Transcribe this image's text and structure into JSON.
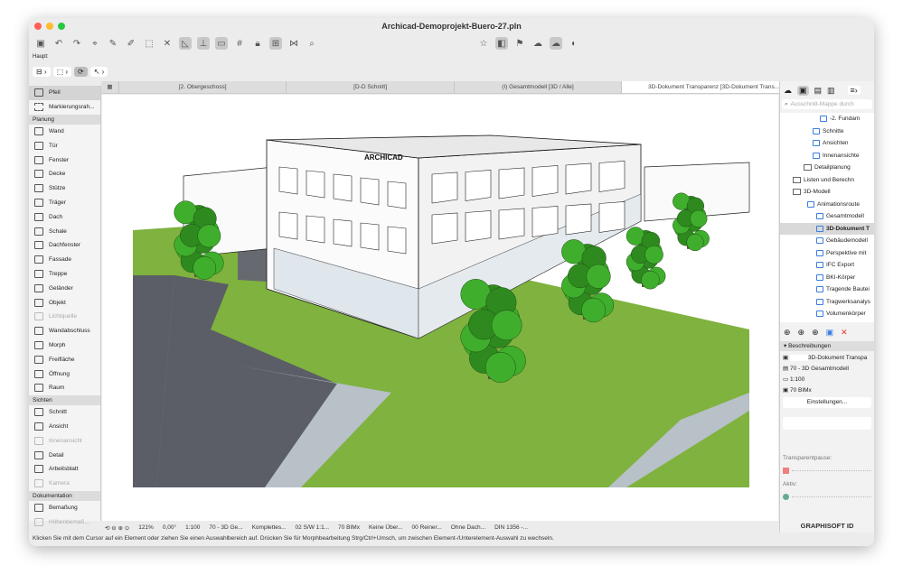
{
  "window": {
    "title": "Archicad-Demoprojekt-Buero-27.pln"
  },
  "toolbar": {
    "haupt_label": "Haupt:"
  },
  "tabs": [
    {
      "label": "[2. Obergeschoss]"
    },
    {
      "label": "[D-D Schnitt]"
    },
    {
      "label": "(I) Gesamtmodell [3D / Alle]"
    },
    {
      "label": "3D-Dokument Transparenz [3D-Dokument Trans..."
    }
  ],
  "sidebar": {
    "top": [
      {
        "label": "Pfeil"
      },
      {
        "label": "Markierungsrah..."
      }
    ],
    "sections": [
      {
        "title": "Planung",
        "items": [
          "Wand",
          "Tür",
          "Fenster",
          "Decke",
          "Stütze",
          "Träger",
          "Dach",
          "Schale",
          "Dachfenster",
          "Fassade",
          "Treppe",
          "Geländer",
          "Objekt",
          "Lichtquelle",
          "Wandabschluss",
          "Morph",
          "Freifläche",
          "Öffnung",
          "Raum"
        ]
      },
      {
        "title": "Sichten",
        "items": [
          "Schnitt",
          "Ansicht",
          "Innenansicht",
          "Detail",
          "Arbeitsblatt",
          "Kamera"
        ]
      },
      {
        "title": "Dokumentation",
        "items": [
          "Bemaßung",
          "Höhenbemaß..."
        ]
      }
    ]
  },
  "navigator": {
    "search_placeholder": "Ausschnitt-Mappe durch",
    "tree": [
      "-2. Fundam",
      "Schnitte",
      "Ansichten",
      "Innenansichte",
      "Detailplanung",
      "Listen und Berechn",
      "3D-Modell",
      "Animationsroute",
      "Gesamtmodell",
      "3D-Dokument T",
      "Gebäudemodell",
      "Perspektive mit",
      "IFC Export",
      "BKI-Körper",
      "Tragende Bautei",
      "Tragwerksanalys",
      "Volumenkörper"
    ],
    "beschreibungen": "Beschreibungen",
    "view_name": "3D-Dokument Transpa",
    "layer_combo": "70 - 3D Gesamtmodell",
    "scale": "1:100",
    "model_view": "70 BIMx",
    "settings_button": "Einstellungen...",
    "transparent_label": "Transparentpause:",
    "active_label": "Aktiv:",
    "brand": "GRAPHISOFT ID"
  },
  "status": {
    "zoom": "121%",
    "angle": "0,00°",
    "scale": "1:100",
    "layers": "70 - 3D Ge...",
    "pen": "Komplettes...",
    "struct": "02 S/W 1:1...",
    "mvo": "70 BIMx",
    "override": "Keine Über...",
    "renov": "00 Reiner...",
    "dim": "Ohne Dach...",
    "std": "DIN 1356 -..."
  },
  "message": "Klicken Sie mit dem Cursor auf ein Element oder ziehen Sie einen Auswahlbereich auf. Drücken Sie für Morphbearbeitung Strg/Ctrl+Umsch, um zwischen Element-/Unterelement-Auswahl zu wechseln.",
  "colors": {
    "grass": "#7fb23e",
    "road": "#5b5e66",
    "tree": "#3fae2c",
    "accent": "#3a7de0"
  }
}
